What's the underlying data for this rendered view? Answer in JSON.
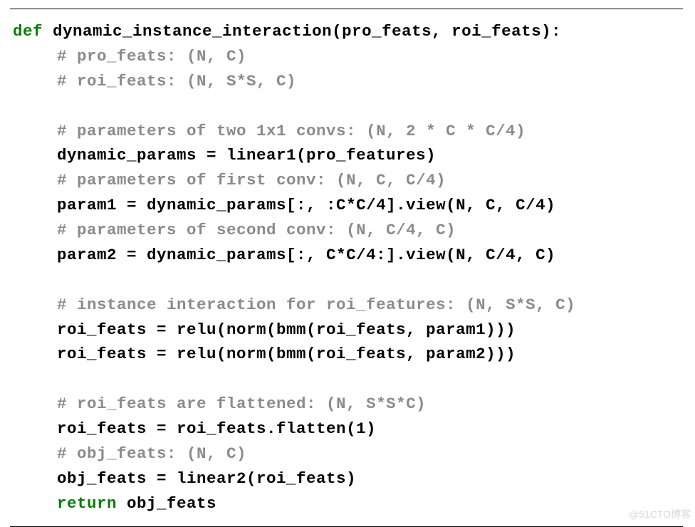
{
  "code": {
    "l1_kw": "def",
    "l1_rest": " dynamic_instance_interaction(pro_feats, roi_feats):",
    "l2": "# pro_feats: (N, C)",
    "l3": "# roi_feats: (N, S*S, C)",
    "l4": "",
    "l5": "# parameters of two 1x1 convs: (N, 2 * C * C/4)",
    "l6": "dynamic_params = linear1(pro_features)",
    "l7": "# parameters of first conv: (N, C, C/4)",
    "l8": "param1 = dynamic_params[:, :C*C/4].view(N, C, C/4)",
    "l9": "# parameters of second conv: (N, C/4, C)",
    "l10": "param2 = dynamic_params[:, C*C/4:].view(N, C/4, C)",
    "l11": "",
    "l12": "# instance interaction for roi_features: (N, S*S, C)",
    "l13": "roi_feats = relu(norm(bmm(roi_feats, param1)))",
    "l14": "roi_feats = relu(norm(bmm(roi_feats, param2)))",
    "l15": "",
    "l16": "# roi_feats are flattened: (N, S*S*C)",
    "l17": "roi_feats = roi_feats.flatten(1)",
    "l18": "# obj_feats: (N, C)",
    "l19": "obj_feats = linear2(roi_feats)",
    "l20_kw": "return",
    "l20_rest": " obj_feats"
  },
  "watermark": "@51CTO博客"
}
